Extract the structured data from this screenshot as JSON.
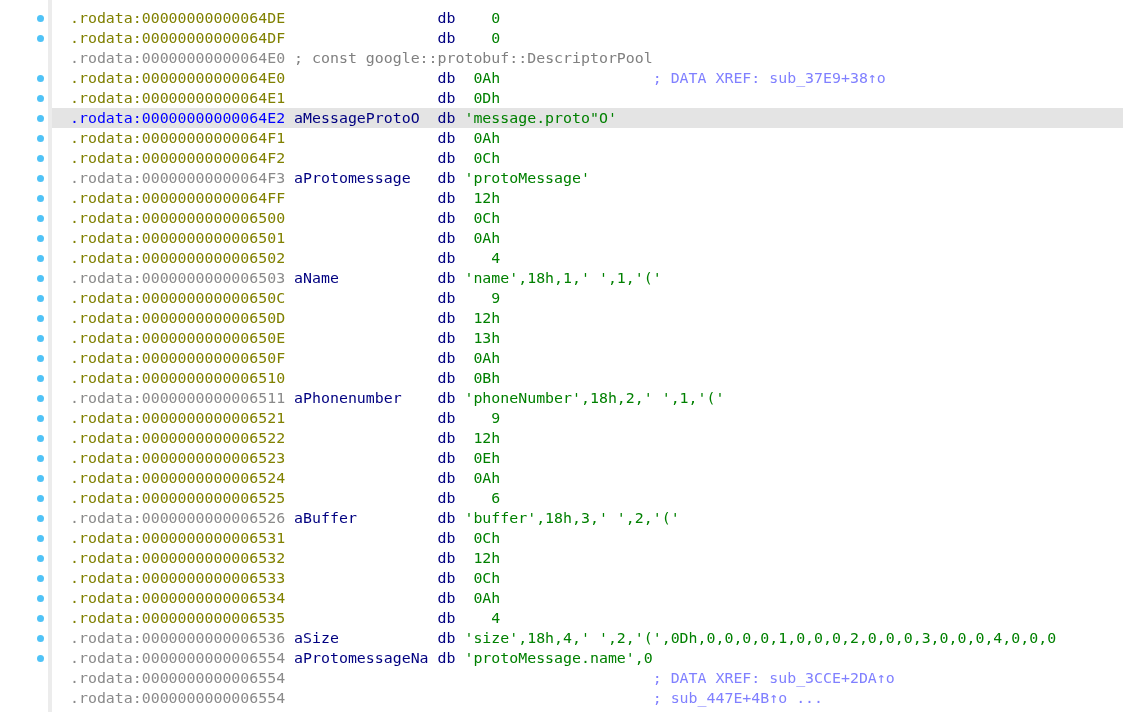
{
  "rows": [
    {
      "address": ".rodata:00000000000064DE",
      "kind": "plain",
      "marked": true,
      "selected": false,
      "mnemonic": "db",
      "operand": {
        "text": "0",
        "kind": "number"
      }
    },
    {
      "address": ".rodata:00000000000064DF",
      "kind": "plain",
      "marked": true,
      "selected": false,
      "mnemonic": "db",
      "operand": {
        "text": "0",
        "kind": "number"
      }
    },
    {
      "address": ".rodata:00000000000064E0",
      "kind": "named",
      "marked": false,
      "selected": false,
      "comment": {
        "text": "; const google::protobuf::DescriptorPool",
        "kind": "note"
      }
    },
    {
      "address": ".rodata:00000000000064E0",
      "kind": "plain",
      "marked": true,
      "selected": false,
      "mnemonic": "db",
      "operand": {
        "text": "0Ah",
        "kind": "number"
      },
      "comment": {
        "text": "; DATA XREF: sub_37E9+38↑o",
        "kind": "xref"
      }
    },
    {
      "address": ".rodata:00000000000064E1",
      "kind": "plain",
      "marked": true,
      "selected": false,
      "mnemonic": "db",
      "operand": {
        "text": "0Dh",
        "kind": "number"
      }
    },
    {
      "address": ".rodata:00000000000064E2",
      "kind": "plain",
      "marked": true,
      "selected": true,
      "label": "aMessageProtoO",
      "mnemonic": "db",
      "operand": {
        "text": "'message.proto\"O'",
        "kind": "string"
      }
    },
    {
      "address": ".rodata:00000000000064F1",
      "kind": "plain",
      "marked": true,
      "selected": false,
      "mnemonic": "db",
      "operand": {
        "text": "0Ah",
        "kind": "number"
      }
    },
    {
      "address": ".rodata:00000000000064F2",
      "kind": "plain",
      "marked": true,
      "selected": false,
      "mnemonic": "db",
      "operand": {
        "text": "0Ch",
        "kind": "number"
      }
    },
    {
      "address": ".rodata:00000000000064F3",
      "kind": "named",
      "marked": true,
      "selected": false,
      "label": "aProtomessage",
      "mnemonic": "db",
      "operand": {
        "text": "'protoMessage'",
        "kind": "string"
      }
    },
    {
      "address": ".rodata:00000000000064FF",
      "kind": "plain",
      "marked": true,
      "selected": false,
      "mnemonic": "db",
      "operand": {
        "text": "12h",
        "kind": "number"
      }
    },
    {
      "address": ".rodata:0000000000006500",
      "kind": "plain",
      "marked": true,
      "selected": false,
      "mnemonic": "db",
      "operand": {
        "text": "0Ch",
        "kind": "number"
      }
    },
    {
      "address": ".rodata:0000000000006501",
      "kind": "plain",
      "marked": true,
      "selected": false,
      "mnemonic": "db",
      "operand": {
        "text": "0Ah",
        "kind": "number"
      }
    },
    {
      "address": ".rodata:0000000000006502",
      "kind": "plain",
      "marked": true,
      "selected": false,
      "mnemonic": "db",
      "operand": {
        "text": "4",
        "kind": "number"
      }
    },
    {
      "address": ".rodata:0000000000006503",
      "kind": "named",
      "marked": true,
      "selected": false,
      "label": "aName",
      "mnemonic": "db",
      "operand": {
        "text": "'name',18h,1,' ',1,'('",
        "kind": "string"
      }
    },
    {
      "address": ".rodata:000000000000650C",
      "kind": "plain",
      "marked": true,
      "selected": false,
      "mnemonic": "db",
      "operand": {
        "text": "9",
        "kind": "number"
      }
    },
    {
      "address": ".rodata:000000000000650D",
      "kind": "plain",
      "marked": true,
      "selected": false,
      "mnemonic": "db",
      "operand": {
        "text": "12h",
        "kind": "number"
      }
    },
    {
      "address": ".rodata:000000000000650E",
      "kind": "plain",
      "marked": true,
      "selected": false,
      "mnemonic": "db",
      "operand": {
        "text": "13h",
        "kind": "number"
      }
    },
    {
      "address": ".rodata:000000000000650F",
      "kind": "plain",
      "marked": true,
      "selected": false,
      "mnemonic": "db",
      "operand": {
        "text": "0Ah",
        "kind": "number"
      }
    },
    {
      "address": ".rodata:0000000000006510",
      "kind": "plain",
      "marked": true,
      "selected": false,
      "mnemonic": "db",
      "operand": {
        "text": "0Bh",
        "kind": "number"
      }
    },
    {
      "address": ".rodata:0000000000006511",
      "kind": "named",
      "marked": true,
      "selected": false,
      "label": "aPhonenumber",
      "mnemonic": "db",
      "operand": {
        "text": "'phoneNumber',18h,2,' ',1,'('",
        "kind": "string"
      }
    },
    {
      "address": ".rodata:0000000000006521",
      "kind": "plain",
      "marked": true,
      "selected": false,
      "mnemonic": "db",
      "operand": {
        "text": "9",
        "kind": "number"
      }
    },
    {
      "address": ".rodata:0000000000006522",
      "kind": "plain",
      "marked": true,
      "selected": false,
      "mnemonic": "db",
      "operand": {
        "text": "12h",
        "kind": "number"
      }
    },
    {
      "address": ".rodata:0000000000006523",
      "kind": "plain",
      "marked": true,
      "selected": false,
      "mnemonic": "db",
      "operand": {
        "text": "0Eh",
        "kind": "number"
      }
    },
    {
      "address": ".rodata:0000000000006524",
      "kind": "plain",
      "marked": true,
      "selected": false,
      "mnemonic": "db",
      "operand": {
        "text": "0Ah",
        "kind": "number"
      }
    },
    {
      "address": ".rodata:0000000000006525",
      "kind": "plain",
      "marked": true,
      "selected": false,
      "mnemonic": "db",
      "operand": {
        "text": "6",
        "kind": "number"
      }
    },
    {
      "address": ".rodata:0000000000006526",
      "kind": "named",
      "marked": true,
      "selected": false,
      "label": "aBuffer",
      "mnemonic": "db",
      "operand": {
        "text": "'buffer',18h,3,' ',2,'('",
        "kind": "string"
      }
    },
    {
      "address": ".rodata:0000000000006531",
      "kind": "plain",
      "marked": true,
      "selected": false,
      "mnemonic": "db",
      "operand": {
        "text": "0Ch",
        "kind": "number"
      }
    },
    {
      "address": ".rodata:0000000000006532",
      "kind": "plain",
      "marked": true,
      "selected": false,
      "mnemonic": "db",
      "operand": {
        "text": "12h",
        "kind": "number"
      }
    },
    {
      "address": ".rodata:0000000000006533",
      "kind": "plain",
      "marked": true,
      "selected": false,
      "mnemonic": "db",
      "operand": {
        "text": "0Ch",
        "kind": "number"
      }
    },
    {
      "address": ".rodata:0000000000006534",
      "kind": "plain",
      "marked": true,
      "selected": false,
      "mnemonic": "db",
      "operand": {
        "text": "0Ah",
        "kind": "number"
      }
    },
    {
      "address": ".rodata:0000000000006535",
      "kind": "plain",
      "marked": true,
      "selected": false,
      "mnemonic": "db",
      "operand": {
        "text": "4",
        "kind": "number"
      }
    },
    {
      "address": ".rodata:0000000000006536",
      "kind": "named",
      "marked": true,
      "selected": false,
      "label": "aSize",
      "mnemonic": "db",
      "operand": {
        "text": "'size',18h,4,' ',2,'(',0Dh,0,0,0,0,1,0,0,0,2,0,0,0,3,0,0,0,4,0,0,0",
        "kind": "string"
      }
    },
    {
      "address": ".rodata:0000000000006554",
      "kind": "named",
      "marked": true,
      "selected": false,
      "label": "aProtomessageNa",
      "mnemonic": "db",
      "operand": {
        "text": "'protoMessage.name',0",
        "kind": "string"
      }
    },
    {
      "address": ".rodata:0000000000006554",
      "kind": "named",
      "marked": false,
      "selected": false,
      "comment": {
        "text": "; DATA XREF: sub_3CCE+2DA↑o",
        "kind": "xref"
      }
    },
    {
      "address": ".rodata:0000000000006554",
      "kind": "named",
      "marked": false,
      "selected": false,
      "comment": {
        "text": "; sub_447E+4B↑o ...",
        "kind": "xref"
      }
    }
  ]
}
